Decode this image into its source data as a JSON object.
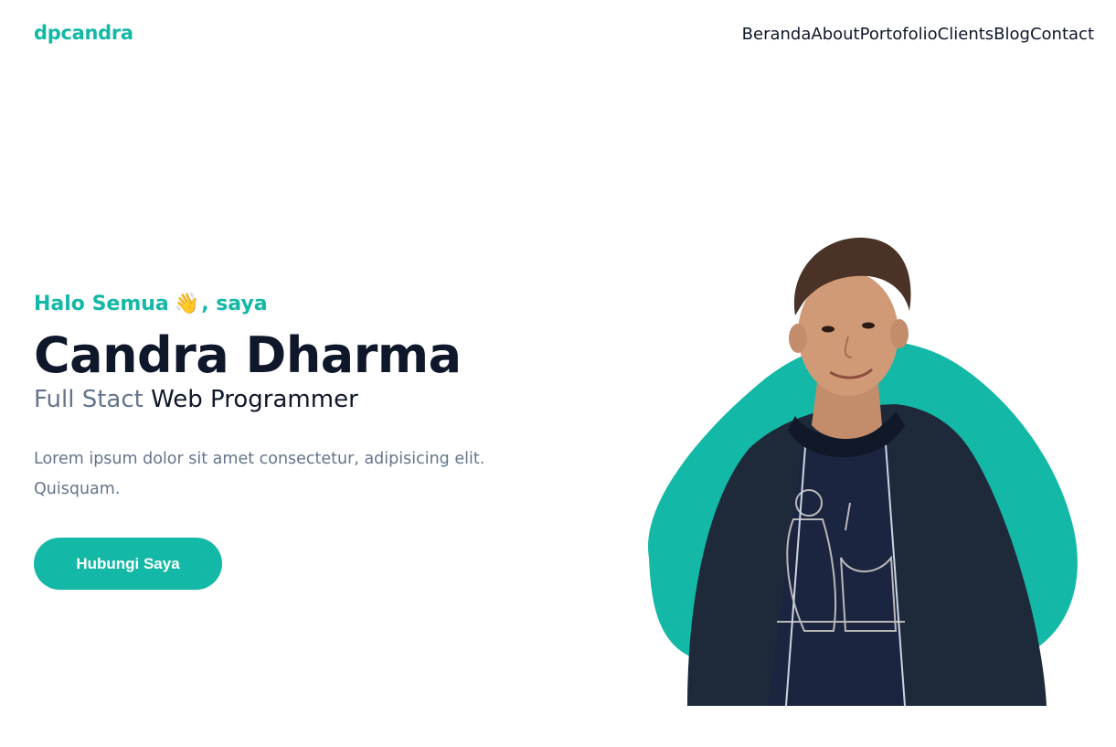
{
  "brand": {
    "logo": "dpcandra",
    "accent_color": "#14b8a6"
  },
  "nav": {
    "items": [
      {
        "label": "Beranda"
      },
      {
        "label": "About"
      },
      {
        "label": "Portofolio"
      },
      {
        "label": "Clients"
      },
      {
        "label": "Blog"
      },
      {
        "label": "Contact"
      }
    ]
  },
  "hero": {
    "greeting": "Halo Semua",
    "greeting_emoji": "👋",
    "greeting_suffix": ", saya",
    "name": "Candra Dharma",
    "role_muted": "Full Stact",
    "role_main": "Web Programmer",
    "description": "Lorem ipsum dolor sit amet consectetur, adipisicing elit. Quisquam.",
    "cta_label": "Hubungi Saya"
  },
  "profile_photo": {
    "icon": "portrait-photo"
  }
}
